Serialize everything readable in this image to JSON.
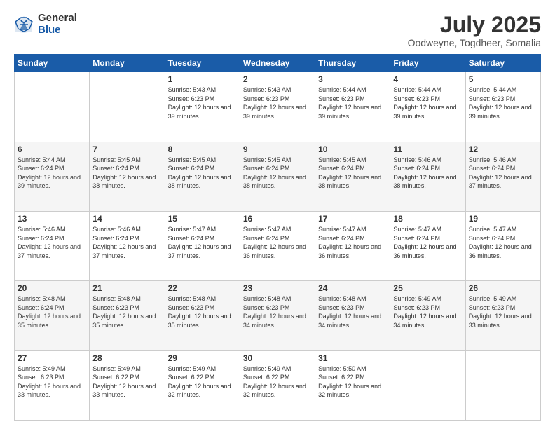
{
  "logo": {
    "general": "General",
    "blue": "Blue"
  },
  "title": "July 2025",
  "location": "Oodweyne, Togdheer, Somalia",
  "days_header": [
    "Sunday",
    "Monday",
    "Tuesday",
    "Wednesday",
    "Thursday",
    "Friday",
    "Saturday"
  ],
  "weeks": [
    [
      {
        "day": "",
        "info": ""
      },
      {
        "day": "",
        "info": ""
      },
      {
        "day": "1",
        "info": "Sunrise: 5:43 AM\nSunset: 6:23 PM\nDaylight: 12 hours and 39 minutes."
      },
      {
        "day": "2",
        "info": "Sunrise: 5:43 AM\nSunset: 6:23 PM\nDaylight: 12 hours and 39 minutes."
      },
      {
        "day": "3",
        "info": "Sunrise: 5:44 AM\nSunset: 6:23 PM\nDaylight: 12 hours and 39 minutes."
      },
      {
        "day": "4",
        "info": "Sunrise: 5:44 AM\nSunset: 6:23 PM\nDaylight: 12 hours and 39 minutes."
      },
      {
        "day": "5",
        "info": "Sunrise: 5:44 AM\nSunset: 6:23 PM\nDaylight: 12 hours and 39 minutes."
      }
    ],
    [
      {
        "day": "6",
        "info": "Sunrise: 5:44 AM\nSunset: 6:24 PM\nDaylight: 12 hours and 39 minutes."
      },
      {
        "day": "7",
        "info": "Sunrise: 5:45 AM\nSunset: 6:24 PM\nDaylight: 12 hours and 38 minutes."
      },
      {
        "day": "8",
        "info": "Sunrise: 5:45 AM\nSunset: 6:24 PM\nDaylight: 12 hours and 38 minutes."
      },
      {
        "day": "9",
        "info": "Sunrise: 5:45 AM\nSunset: 6:24 PM\nDaylight: 12 hours and 38 minutes."
      },
      {
        "day": "10",
        "info": "Sunrise: 5:45 AM\nSunset: 6:24 PM\nDaylight: 12 hours and 38 minutes."
      },
      {
        "day": "11",
        "info": "Sunrise: 5:46 AM\nSunset: 6:24 PM\nDaylight: 12 hours and 38 minutes."
      },
      {
        "day": "12",
        "info": "Sunrise: 5:46 AM\nSunset: 6:24 PM\nDaylight: 12 hours and 37 minutes."
      }
    ],
    [
      {
        "day": "13",
        "info": "Sunrise: 5:46 AM\nSunset: 6:24 PM\nDaylight: 12 hours and 37 minutes."
      },
      {
        "day": "14",
        "info": "Sunrise: 5:46 AM\nSunset: 6:24 PM\nDaylight: 12 hours and 37 minutes."
      },
      {
        "day": "15",
        "info": "Sunrise: 5:47 AM\nSunset: 6:24 PM\nDaylight: 12 hours and 37 minutes."
      },
      {
        "day": "16",
        "info": "Sunrise: 5:47 AM\nSunset: 6:24 PM\nDaylight: 12 hours and 36 minutes."
      },
      {
        "day": "17",
        "info": "Sunrise: 5:47 AM\nSunset: 6:24 PM\nDaylight: 12 hours and 36 minutes."
      },
      {
        "day": "18",
        "info": "Sunrise: 5:47 AM\nSunset: 6:24 PM\nDaylight: 12 hours and 36 minutes."
      },
      {
        "day": "19",
        "info": "Sunrise: 5:47 AM\nSunset: 6:24 PM\nDaylight: 12 hours and 36 minutes."
      }
    ],
    [
      {
        "day": "20",
        "info": "Sunrise: 5:48 AM\nSunset: 6:24 PM\nDaylight: 12 hours and 35 minutes."
      },
      {
        "day": "21",
        "info": "Sunrise: 5:48 AM\nSunset: 6:23 PM\nDaylight: 12 hours and 35 minutes."
      },
      {
        "day": "22",
        "info": "Sunrise: 5:48 AM\nSunset: 6:23 PM\nDaylight: 12 hours and 35 minutes."
      },
      {
        "day": "23",
        "info": "Sunrise: 5:48 AM\nSunset: 6:23 PM\nDaylight: 12 hours and 34 minutes."
      },
      {
        "day": "24",
        "info": "Sunrise: 5:48 AM\nSunset: 6:23 PM\nDaylight: 12 hours and 34 minutes."
      },
      {
        "day": "25",
        "info": "Sunrise: 5:49 AM\nSunset: 6:23 PM\nDaylight: 12 hours and 34 minutes."
      },
      {
        "day": "26",
        "info": "Sunrise: 5:49 AM\nSunset: 6:23 PM\nDaylight: 12 hours and 33 minutes."
      }
    ],
    [
      {
        "day": "27",
        "info": "Sunrise: 5:49 AM\nSunset: 6:23 PM\nDaylight: 12 hours and 33 minutes."
      },
      {
        "day": "28",
        "info": "Sunrise: 5:49 AM\nSunset: 6:22 PM\nDaylight: 12 hours and 33 minutes."
      },
      {
        "day": "29",
        "info": "Sunrise: 5:49 AM\nSunset: 6:22 PM\nDaylight: 12 hours and 32 minutes."
      },
      {
        "day": "30",
        "info": "Sunrise: 5:49 AM\nSunset: 6:22 PM\nDaylight: 12 hours and 32 minutes."
      },
      {
        "day": "31",
        "info": "Sunrise: 5:50 AM\nSunset: 6:22 PM\nDaylight: 12 hours and 32 minutes."
      },
      {
        "day": "",
        "info": ""
      },
      {
        "day": "",
        "info": ""
      }
    ]
  ]
}
